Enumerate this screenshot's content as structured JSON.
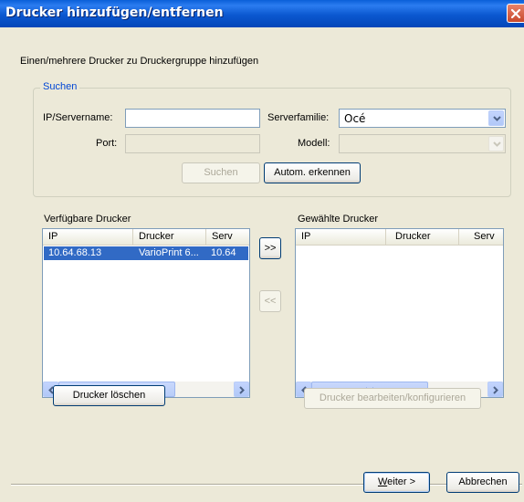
{
  "window": {
    "title": "Drucker hinzufügen/entfernen"
  },
  "instruction": "Einen/mehrere Drucker zu Druckergruppe hinzufügen",
  "search_group": {
    "label": "Suchen",
    "ip_label": "IP/Servername:",
    "ip_value": "",
    "port_label": "Port:",
    "port_value": "",
    "server_family_label": "Serverfamilie:",
    "server_family_value": "Océ",
    "model_label": "Modell:",
    "model_value": "",
    "search_button": "Suchen",
    "auto_detect_button": "Autom. erkennen"
  },
  "available": {
    "label": "Verfügbare Drucker",
    "columns": [
      "IP",
      "Drucker",
      "Serv"
    ],
    "rows": [
      {
        "ip": "10.64.68.13",
        "printer": "VarioPrint 6...",
        "server": "10.64"
      }
    ]
  },
  "selected": {
    "label": "Gewählte Drucker",
    "columns": [
      "IP",
      "Drucker",
      "Serv"
    ]
  },
  "transfer": {
    "add": ">>",
    "remove": "<<"
  },
  "buttons": {
    "delete_printer": "Drucker löschen",
    "edit_printer": "Drucker bearbeiten/konfigurieren",
    "next_prefix": "W",
    "next_rest": "eiter >",
    "cancel": "Abbrechen"
  },
  "colors": {
    "title_bar": "#0a5fd8",
    "group_label": "#0046d5",
    "selection": "#316ac5",
    "dialog_bg": "#ece9d8"
  }
}
